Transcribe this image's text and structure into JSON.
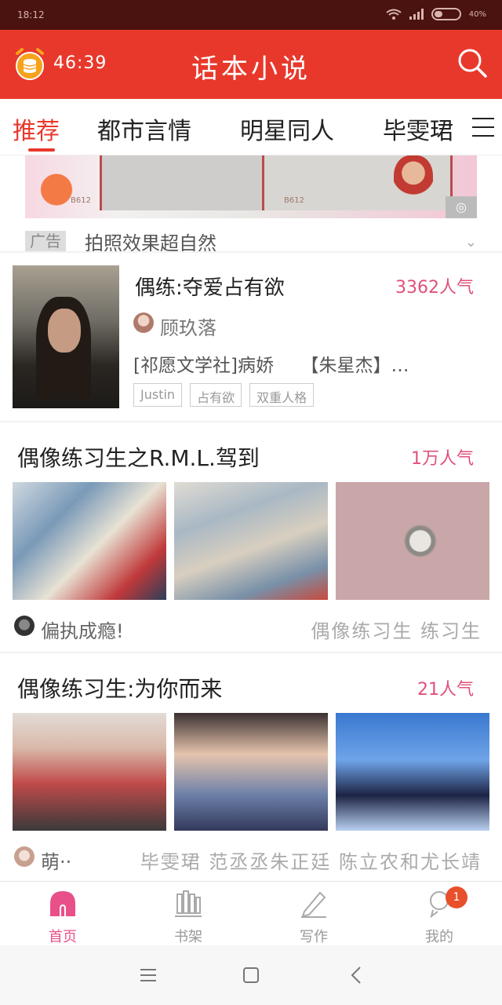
{
  "status_bar": {
    "time": "18:12",
    "battery": "40%"
  },
  "app_bar": {
    "timer": "46:39",
    "title": "话本小说"
  },
  "tabs": [
    {
      "label": "推荐",
      "active": true
    },
    {
      "label": "都市言情"
    },
    {
      "label": "明星同人"
    },
    {
      "label": "毕雯珺"
    }
  ],
  "ad": {
    "tag": "广告",
    "text": "拍照效果超自然",
    "banner_badges": [
      "B612",
      "B612"
    ]
  },
  "book1": {
    "title": "偶练:夺爱占有欲",
    "popularity": "3362人气",
    "author": "顾玖落",
    "description": "[祁愿文学社]病娇　　【朱星杰】…",
    "tags": [
      "Justin",
      "占有欲",
      "双重人格"
    ]
  },
  "group1": {
    "title": "偶像练习生之R.M.L.驾到",
    "popularity": "1万人气",
    "author": "偏执成瘾!",
    "tags": "偶像练习生 练习生"
  },
  "group2": {
    "title": "偶像练习生:为你而来",
    "popularity": "21人气",
    "author": "萌··",
    "tags": "毕雯珺 范丞丞朱正廷 陈立农和尤长靖"
  },
  "bottom_nav": [
    {
      "label": "首页",
      "icon": "home-icon",
      "active": true,
      "color": "#e8508a"
    },
    {
      "label": "书架",
      "icon": "bookshelf-icon"
    },
    {
      "label": "写作",
      "icon": "pencil-icon"
    },
    {
      "label": "我的",
      "icon": "profile-icon",
      "badge": "1"
    }
  ],
  "colors": {
    "brand": "#e8382b",
    "accent": "#e0507a"
  }
}
